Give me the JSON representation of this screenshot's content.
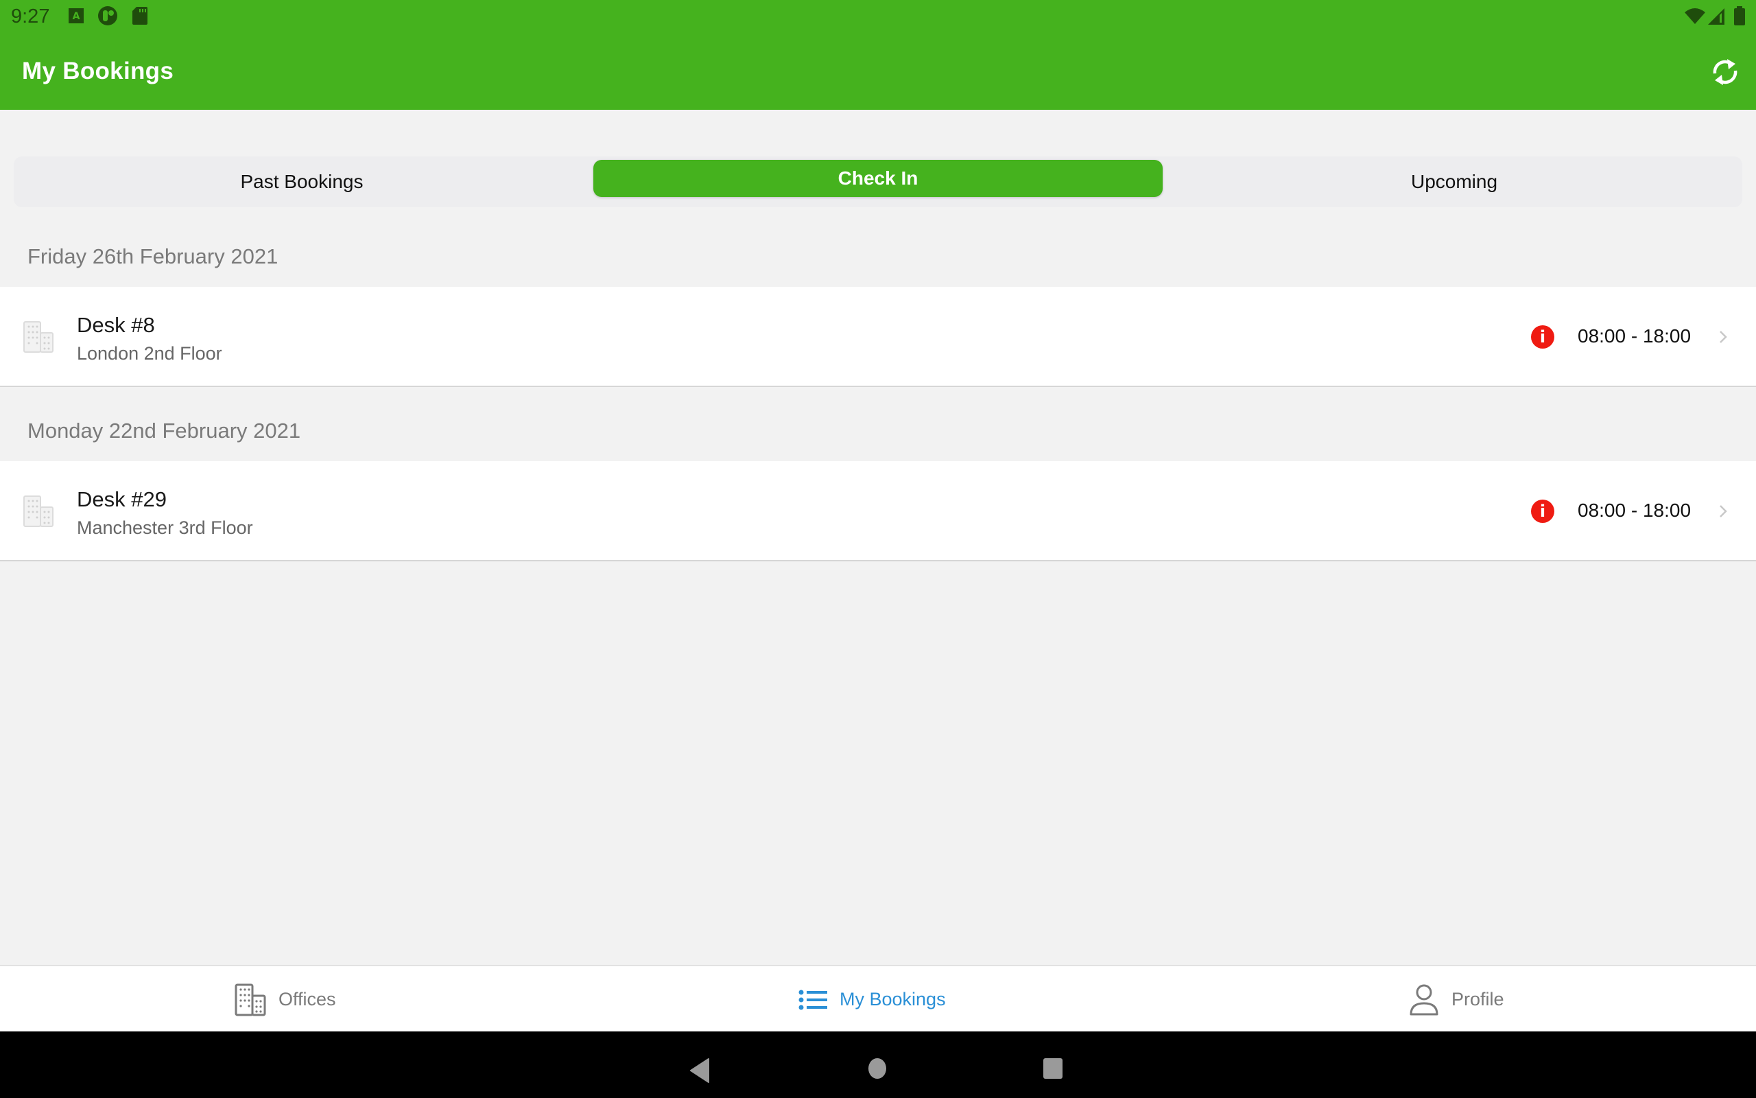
{
  "status_bar": {
    "time": "9:27",
    "left_icons": [
      "font-a-icon",
      "app-circle-icon",
      "sd-card-icon"
    ],
    "right_icons": [
      "wifi-icon",
      "cell-signal-icon",
      "battery-icon"
    ]
  },
  "header": {
    "title": "My Bookings",
    "action_icon": "sync-icon"
  },
  "segments": [
    {
      "label": "Past Bookings",
      "active": false
    },
    {
      "label": "Check In",
      "active": true
    },
    {
      "label": "Upcoming",
      "active": false
    }
  ],
  "groups": [
    {
      "date": "Friday 26th February 2021",
      "items": [
        {
          "title": "Desk #8",
          "location": "London 2nd Floor",
          "time": "08:00 - 18:00",
          "status_icon": "info-icon"
        }
      ]
    },
    {
      "date": "Monday 22nd February 2021",
      "items": [
        {
          "title": "Desk #29",
          "location": "Manchester 3rd Floor",
          "time": "08:00 - 18:00",
          "status_icon": "info-icon"
        }
      ]
    }
  ],
  "tabbar": {
    "tabs": [
      {
        "label": "Offices",
        "icon": "building-icon",
        "active": false
      },
      {
        "label": "My Bookings",
        "icon": "list-icon",
        "active": true
      },
      {
        "label": "Profile",
        "icon": "person-icon",
        "active": false
      }
    ]
  },
  "colors": {
    "brand_green": "#45b21e",
    "active_tab_blue": "#2a8fd6",
    "alert_red": "#ef1b12"
  }
}
